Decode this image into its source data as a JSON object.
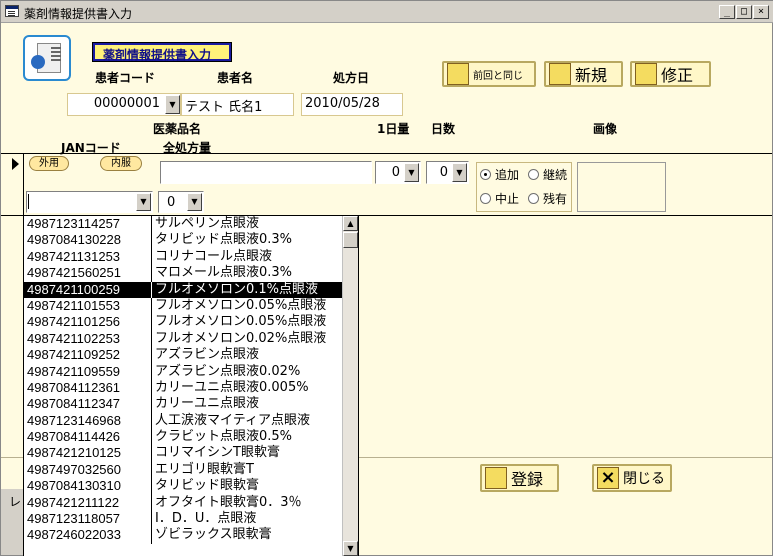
{
  "window": {
    "title": "薬剤情報提供書入力",
    "min": "_",
    "max": "□",
    "close": "×"
  },
  "form": {
    "heading": "薬剤情報提供書入力"
  },
  "patient": {
    "code_label": "患者コード",
    "name_label": "患者名",
    "date_label": "処方日",
    "code_value": "00000001",
    "name_value": "テスト 氏名1",
    "date_value": "2010/05/28"
  },
  "toolbar": {
    "same_label": "前回と同じ",
    "new_label": "新規",
    "edit_label": "修正"
  },
  "grid_headers": {
    "drug_name": "医薬品名",
    "daily": "1日量",
    "days": "日数",
    "image": "画像",
    "jan": "JANコード",
    "total": "全処方量"
  },
  "entry": {
    "tag_external": "外用",
    "tag_internal": "内服",
    "daily_value": "0",
    "days_value": "0",
    "qty_value": "0",
    "jan_value": ""
  },
  "status_radios": [
    {
      "label": "追加",
      "checked": true
    },
    {
      "label": "継続",
      "checked": false
    },
    {
      "label": "中止",
      "checked": false
    },
    {
      "label": "残有",
      "checked": false
    }
  ],
  "drug_list": [
    {
      "jan": "4987123114257",
      "name": "サルペリン点眼液",
      "selected": false
    },
    {
      "jan": "4987084130228",
      "name": "タリビッド点眼液0.3%",
      "selected": false
    },
    {
      "jan": "4987421131253",
      "name": "コリナコール点眼液",
      "selected": false
    },
    {
      "jan": "4987421560251",
      "name": "マロメール点眼液0.3%",
      "selected": false
    },
    {
      "jan": "4987421100259",
      "name": "フルオメソロン0.1%点眼液",
      "selected": true
    },
    {
      "jan": "4987421101553",
      "name": "フルオメソロン0.05%点眼液",
      "selected": false
    },
    {
      "jan": "4987421101256",
      "name": "フルオメソロン0.05%点眼液",
      "selected": false
    },
    {
      "jan": "4987421102253",
      "name": "フルオメソロン0.02%点眼液",
      "selected": false
    },
    {
      "jan": "4987421109252",
      "name": "アズラビン点眼液",
      "selected": false
    },
    {
      "jan": "4987421109559",
      "name": "アズラビン点眼液0.02%",
      "selected": false
    },
    {
      "jan": "4987084112361",
      "name": "カリーユニ点眼液0.005%",
      "selected": false
    },
    {
      "jan": "4987084112347",
      "name": "カリーユニ点眼液",
      "selected": false
    },
    {
      "jan": "4987123146968",
      "name": "人工涙液マイティア点眼液",
      "selected": false
    },
    {
      "jan": "4987084114426",
      "name": "クラビット点眼液0.5%",
      "selected": false
    },
    {
      "jan": "4987421210125",
      "name": "コリマイシンT眼軟膏",
      "selected": false
    },
    {
      "jan": "4987497032560",
      "name": "エリゴリ眼軟膏T",
      "selected": false
    },
    {
      "jan": "4987084130310",
      "name": "タリビッド眼軟膏",
      "selected": false
    },
    {
      "jan": "4987421211122",
      "name": "オフタイト眼軟膏0．3％",
      "selected": false
    },
    {
      "jan": "4987123118057",
      "name": "I．D．U．点眼液",
      "selected": false
    },
    {
      "jan": "4987246022033",
      "name": "ゾビラックス眼軟膏",
      "selected": false
    }
  ],
  "footer": {
    "register_label": "登録",
    "close_label": "閉じる",
    "partial_text": "レ"
  }
}
